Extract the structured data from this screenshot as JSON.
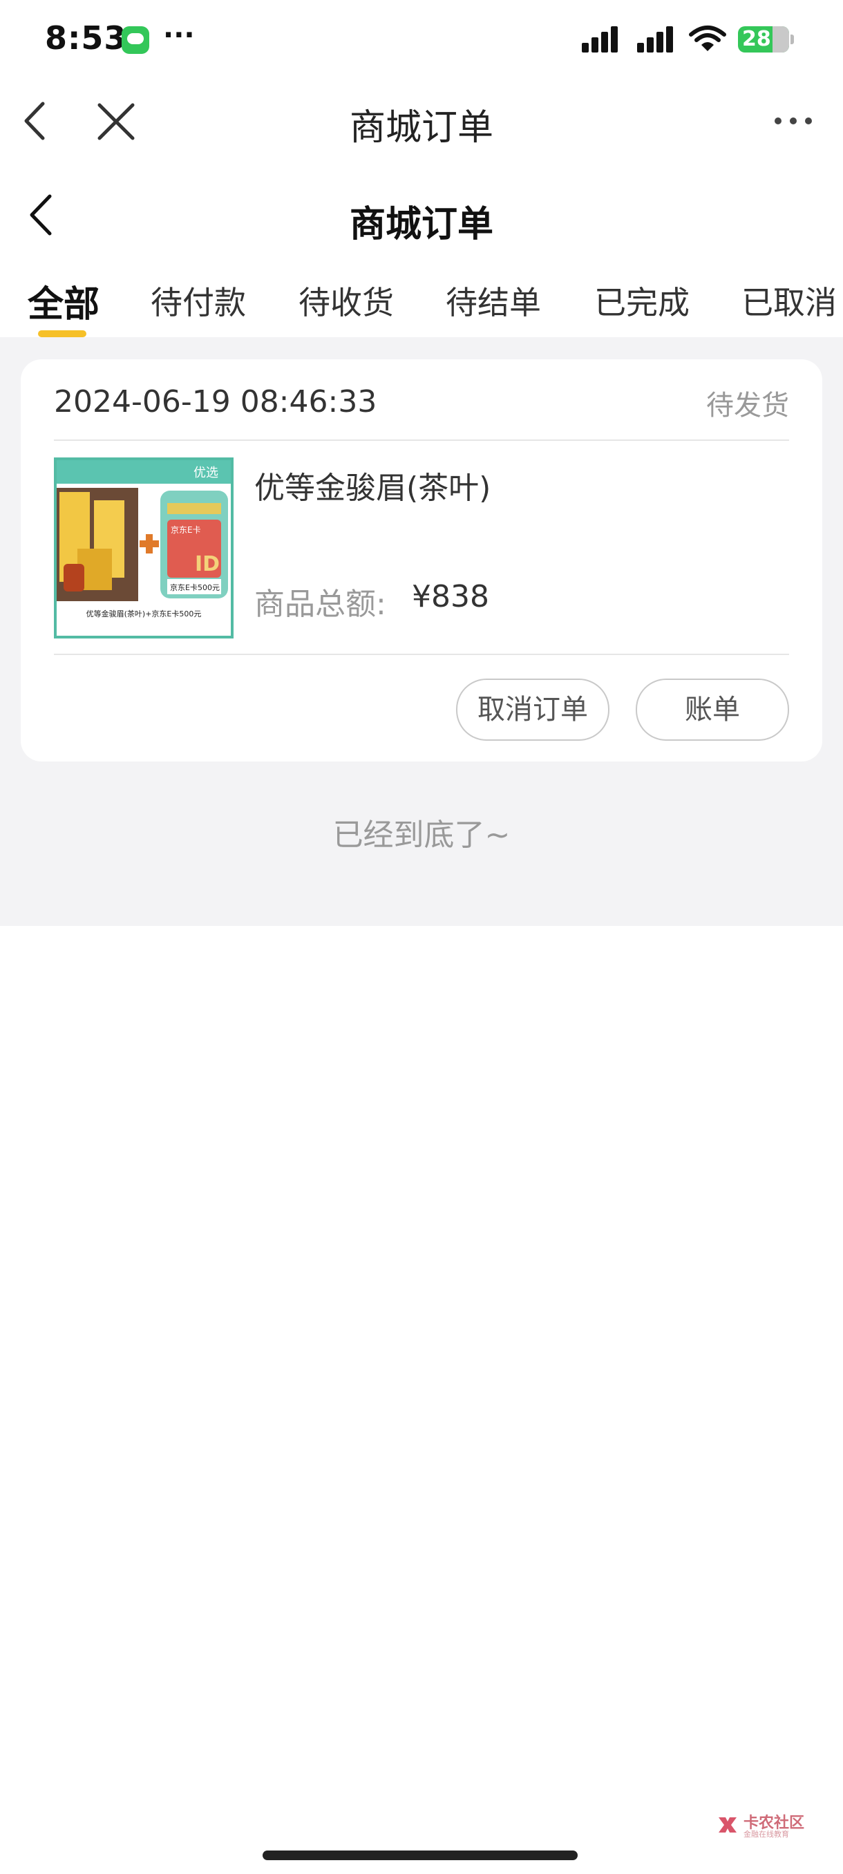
{
  "status_bar": {
    "time": "8:53",
    "more_glyph": "···",
    "battery_level": "28"
  },
  "nav_bar": {
    "title": "商城订单"
  },
  "page": {
    "title": "商城订单"
  },
  "tabs": [
    {
      "label": "全部",
      "active": true
    },
    {
      "label": "待付款",
      "active": false
    },
    {
      "label": "待收货",
      "active": false
    },
    {
      "label": "待结单",
      "active": false
    },
    {
      "label": "已完成",
      "active": false
    },
    {
      "label": "已取消",
      "active": false
    }
  ],
  "order": {
    "time": "2024-06-19 08:46:33",
    "status": "待发货",
    "product_name": "优等金骏眉(茶叶)",
    "total_label": "商品总额:",
    "total_value": "¥838",
    "image": {
      "badge": "优选",
      "caption": "优等金骏眉(茶叶)+京东E卡500元",
      "card_top": "京东E卡",
      "card_label": "京东E卡500元"
    },
    "buttons": {
      "cancel": "取消订单",
      "bill": "账单"
    }
  },
  "list_end_text": "已经到底了~",
  "watermark": {
    "title": "卡农社区",
    "subtitle": "金融在线教育"
  },
  "colors": {
    "accent_yellow": "#f6c028",
    "battery_green": "#34c759",
    "background_gray": "#f3f3f5",
    "image_border": "#53bba4"
  }
}
